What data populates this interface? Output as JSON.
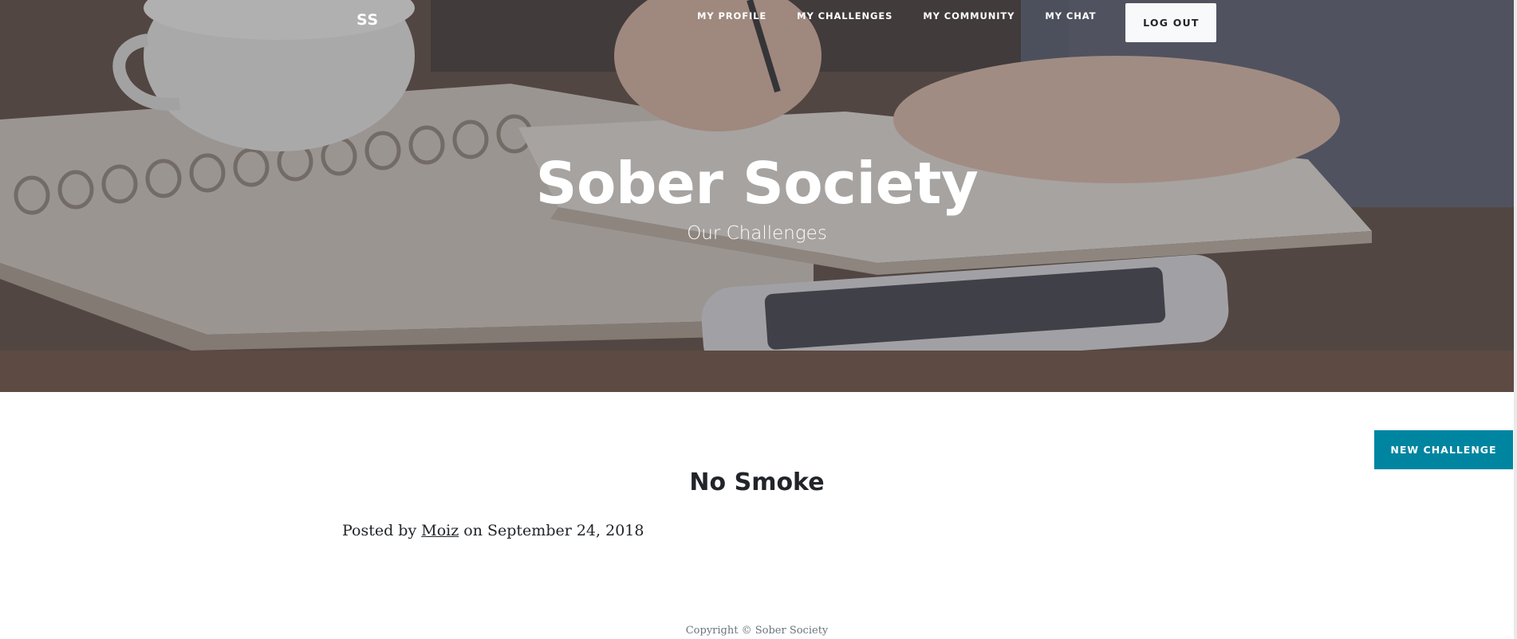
{
  "nav": {
    "brand": "SS",
    "links": [
      "My Profile",
      "My Challenges",
      "My Community",
      "My Chat"
    ],
    "logout_label": "Log Out"
  },
  "hero": {
    "title": "Sober Society",
    "subtitle": "Our Challenges"
  },
  "actions": {
    "new_challenge_label": "New Challenge"
  },
  "post": {
    "title": "No Smoke",
    "meta_prefix": "Posted by",
    "author": "Moiz",
    "meta_mid": "on",
    "date": "September 24, 2018"
  },
  "footer": {
    "copyright": "Copyright © Sober Society"
  },
  "colors": {
    "accent": "#0085a1",
    "text_dark": "#212529",
    "muted": "#6c757d"
  }
}
